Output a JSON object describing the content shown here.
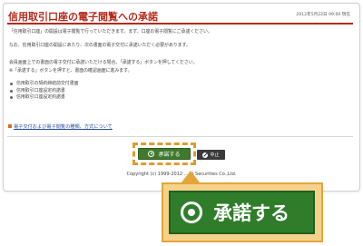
{
  "header": {
    "title": "信用取引口座の電子閲覧への承諾",
    "date": "2012年5月22日 09:00 現在"
  },
  "body": {
    "para1": "「信用取引口座」の開設は電子閲覧で行っていただきます。まず、口座の電子閲覧にご承諾ください。",
    "para2": "なお、信用取引口座の開設にあたり、次の書面の電子交付に承諾いただく必要があります。",
    "para3_line1": "会員画面上での書面の電子交付に承諾いただける場合、「承諾する」ボタンを押してください。",
    "para3_line2": "※「承諾する」ボタンを押すと、書面の確認画面に進みます。",
    "bullets": [
      "信用取引の契約締結前交付書面",
      "信用取引口座設定約諾書",
      "信用取引口座設定約諾書"
    ],
    "link": "電子交付および電子閲覧の種類、方式について"
  },
  "buttons": {
    "accept_small": "承諾する",
    "cancel": "中止",
    "accept_large": "承諾する"
  },
  "footer": {
    "copyright": "Copyright (c) 1999-2012 ... al Securities Co.,Ltd."
  },
  "colors": {
    "title_red": "#b52a1c",
    "button_green": "#2f7d2b",
    "highlight_orange": "#e3a53a",
    "link_blue": "#2a4f9e"
  },
  "icons": {
    "accept_icon": "circle-dot-icon",
    "cancel_icon": "no-entry-icon"
  }
}
